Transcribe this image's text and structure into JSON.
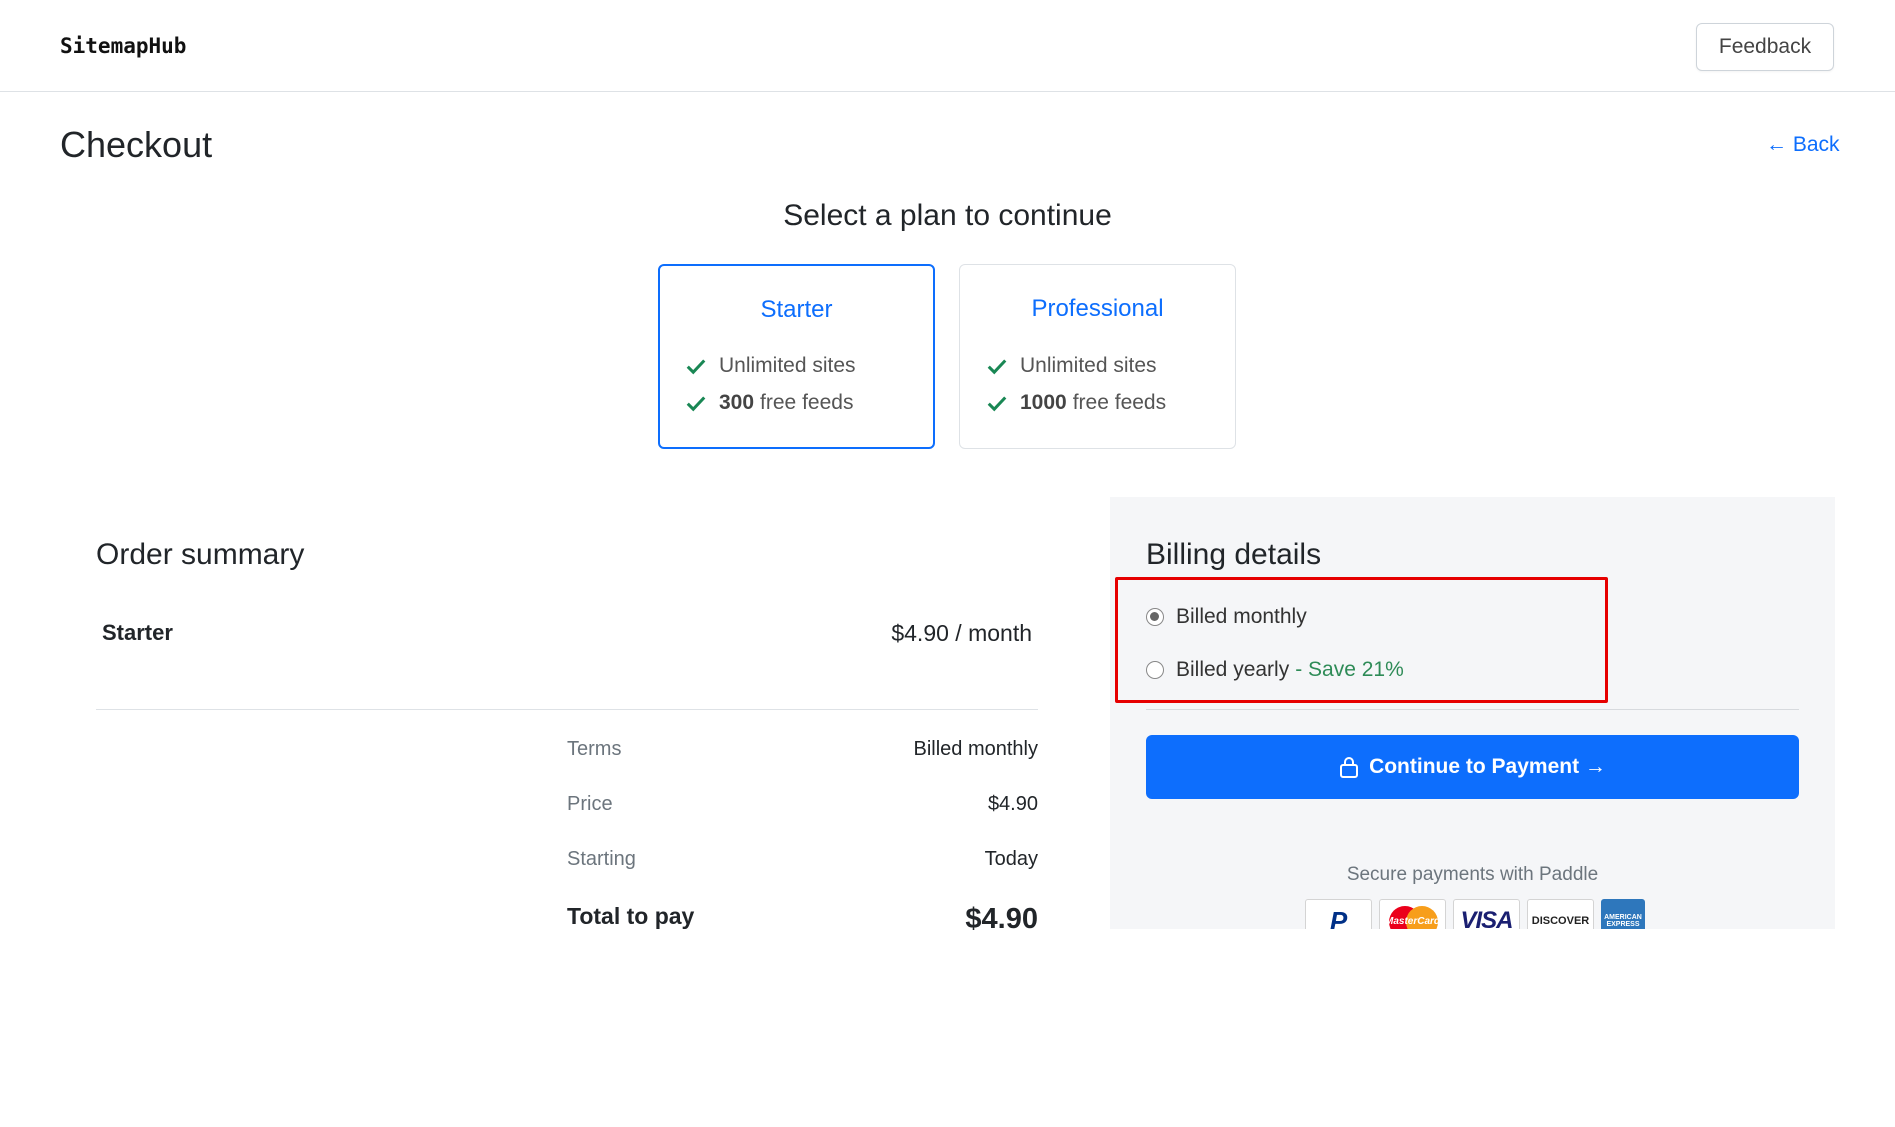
{
  "header": {
    "brand": "SitemapHub",
    "feedback_label": "Feedback"
  },
  "page": {
    "title": "Checkout",
    "back_label": "← Back",
    "plan_heading": "Select a plan to continue"
  },
  "plans": [
    {
      "name": "Starter",
      "selected": true,
      "features": [
        {
          "num": "",
          "text": "Unlimited sites"
        },
        {
          "num": "300",
          "text": "free feeds"
        }
      ]
    },
    {
      "name": "Professional",
      "selected": false,
      "features": [
        {
          "num": "",
          "text": "Unlimited sites"
        },
        {
          "num": "1000",
          "text": "free feeds"
        }
      ]
    }
  ],
  "order_summary": {
    "title": "Order summary",
    "plan_name": "Starter",
    "plan_price": "$4.90 / month",
    "rows": [
      {
        "label": "Terms",
        "value": "Billed monthly"
      },
      {
        "label": "Price",
        "value": "$4.90"
      },
      {
        "label": "Starting",
        "value": "Today"
      }
    ],
    "total_label": "Total to pay",
    "total_value": "$4.90"
  },
  "billing": {
    "title": "Billing details",
    "options": [
      {
        "label": "Billed monthly",
        "extra": "",
        "checked": true
      },
      {
        "label": "Billed yearly",
        "extra": "- Save 21%",
        "checked": false
      }
    ],
    "pay_button_label": "Continue to Payment →",
    "secure_text": "Secure payments with Paddle",
    "card_logos": [
      "PayPal",
      "MasterCard",
      "VISA",
      "DISCOVER",
      "AMERICAN EXPRESS"
    ]
  },
  "colors": {
    "accent": "#0d6efd",
    "check_green": "#198754",
    "save_green": "#2e8b57",
    "highlight_red": "#e60000"
  }
}
